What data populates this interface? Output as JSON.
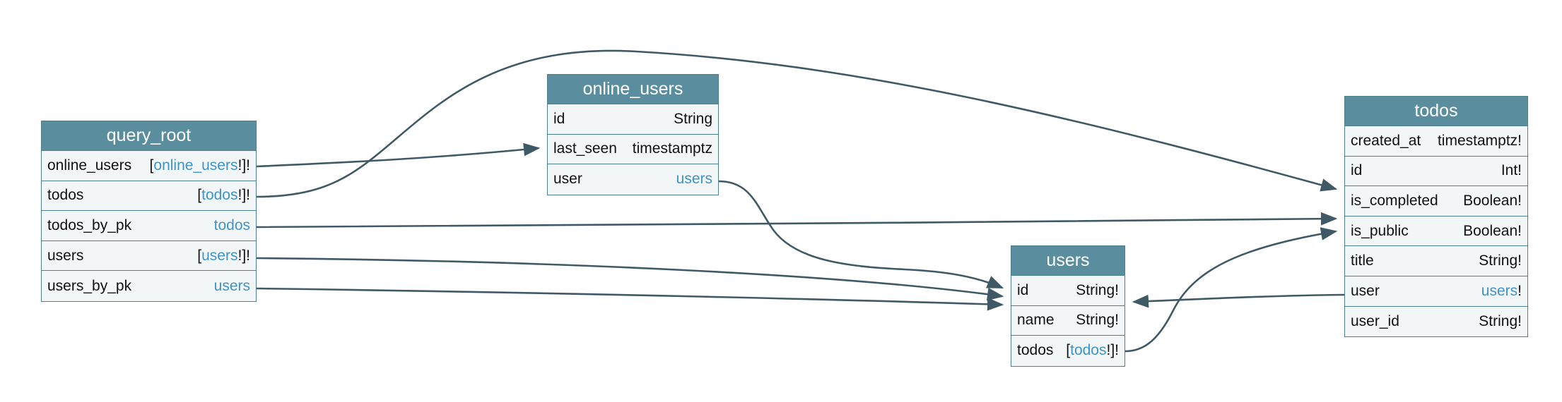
{
  "colors": {
    "header": "#5a8e9e",
    "border": "#4e7f8f",
    "row": "#f3f6f7",
    "link": "#3e94c9",
    "edge": "#3f5a66"
  },
  "nodes": [
    {
      "id": "query_root",
      "title": "query_root",
      "fields": [
        {
          "name": "online_users",
          "pre": "[",
          "link": "online_users",
          "post": "!]!"
        },
        {
          "name": "todos",
          "pre": "[",
          "link": "todos",
          "post": "!]!"
        },
        {
          "name": "todos_by_pk",
          "pre": "",
          "link": "todos",
          "post": ""
        },
        {
          "name": "users",
          "pre": "[",
          "link": "users",
          "post": "!]!"
        },
        {
          "name": "users_by_pk",
          "pre": "",
          "link": "users",
          "post": ""
        }
      ]
    },
    {
      "id": "online_users",
      "title": "online_users",
      "fields": [
        {
          "name": "id",
          "pre": "String",
          "link": "",
          "post": ""
        },
        {
          "name": "last_seen",
          "pre": "timestamptz",
          "link": "",
          "post": ""
        },
        {
          "name": "user",
          "pre": "",
          "link": "users",
          "post": ""
        }
      ]
    },
    {
      "id": "users",
      "title": "users",
      "fields": [
        {
          "name": "id",
          "pre": "String!",
          "link": "",
          "post": ""
        },
        {
          "name": "name",
          "pre": "String!",
          "link": "",
          "post": ""
        },
        {
          "name": "todos",
          "pre": "[",
          "link": "todos",
          "post": "!]!"
        }
      ]
    },
    {
      "id": "todos",
      "title": "todos",
      "fields": [
        {
          "name": "created_at",
          "pre": "timestamptz!",
          "link": "",
          "post": ""
        },
        {
          "name": "id",
          "pre": "Int!",
          "link": "",
          "post": ""
        },
        {
          "name": "is_completed",
          "pre": "Boolean!",
          "link": "",
          "post": ""
        },
        {
          "name": "is_public",
          "pre": "Boolean!",
          "link": "",
          "post": ""
        },
        {
          "name": "title",
          "pre": "String!",
          "link": "",
          "post": ""
        },
        {
          "name": "user",
          "pre": "",
          "link": "users",
          "post": "!"
        },
        {
          "name": "user_id",
          "pre": "String!",
          "link": "",
          "post": ""
        }
      ]
    }
  ],
  "edges": [
    {
      "from": "query_root.online_users",
      "to": "online_users"
    },
    {
      "from": "query_root.todos",
      "to": "todos"
    },
    {
      "from": "query_root.todos_by_pk",
      "to": "todos"
    },
    {
      "from": "query_root.users",
      "to": "users"
    },
    {
      "from": "query_root.users_by_pk",
      "to": "users"
    },
    {
      "from": "online_users.user",
      "to": "users"
    },
    {
      "from": "users.todos",
      "to": "todos"
    },
    {
      "from": "todos.user",
      "to": "users"
    }
  ]
}
